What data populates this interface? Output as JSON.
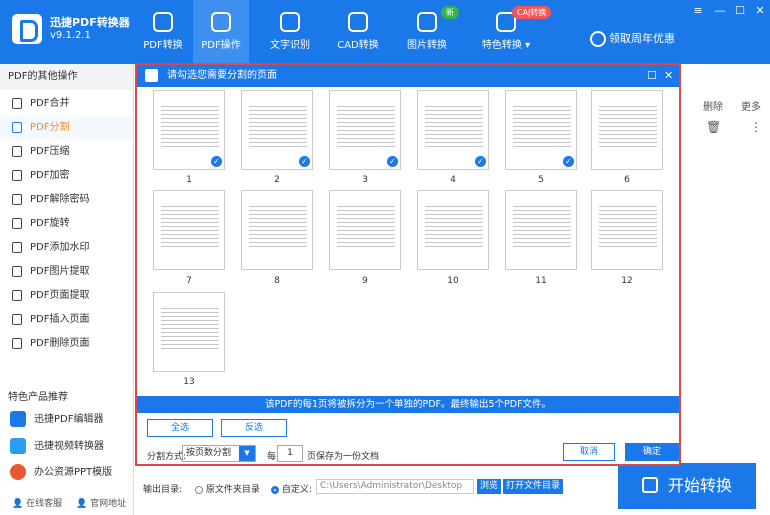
{
  "app": {
    "name": "迅捷PDF转换器",
    "version": "v9.1.2.1"
  },
  "nav": [
    {
      "label": "PDF转换",
      "icon": "convert-icon"
    },
    {
      "label": "PDF操作",
      "icon": "pdf-operate-icon",
      "active": true
    },
    {
      "label": "文字识别",
      "icon": "ocr-icon"
    },
    {
      "label": "CAD转换",
      "icon": "cad-icon"
    },
    {
      "label": "图片转换",
      "icon": "image-icon",
      "badge": "新"
    },
    {
      "label": "特色转换",
      "icon": "special-icon",
      "badge": "CAJ转换"
    }
  ],
  "promo": "领取周年优惠",
  "sidebar": {
    "heading": "PDF的其他操作",
    "items": [
      {
        "label": "PDF合并",
        "icon": "merge-icon"
      },
      {
        "label": "PDF分割",
        "icon": "split-icon",
        "active": true
      },
      {
        "label": "PDF压缩",
        "icon": "compress-icon"
      },
      {
        "label": "PDF加密",
        "icon": "lock-icon"
      },
      {
        "label": "PDF解除密码",
        "icon": "unlock-icon"
      },
      {
        "label": "PDF旋转",
        "icon": "rotate-icon"
      },
      {
        "label": "PDF添加水印",
        "icon": "watermark-icon"
      },
      {
        "label": "PDF图片提取",
        "icon": "image-extract-icon"
      },
      {
        "label": "PDF页面提取",
        "icon": "page-extract-icon"
      },
      {
        "label": "PDF插入页面",
        "icon": "insert-page-icon"
      },
      {
        "label": "PDF删除页面",
        "icon": "delete-page-icon"
      }
    ],
    "products_heading": "特色产品推荐",
    "products": [
      "迅捷PDF编辑器",
      "迅捷视频转换器",
      "办公资源PPT模版"
    ],
    "footer": [
      "在线客服",
      "官网地址"
    ]
  },
  "table_cols": {
    "delete": "删除",
    "more": "更多"
  },
  "dialog": {
    "title": "请勾选您需要分割的页面",
    "pages": [
      {
        "n": "1",
        "checked": true
      },
      {
        "n": "2",
        "checked": true
      },
      {
        "n": "3",
        "checked": true
      },
      {
        "n": "4",
        "checked": true
      },
      {
        "n": "5",
        "checked": true
      },
      {
        "n": "6",
        "checked": false
      },
      {
        "n": "7",
        "checked": false
      },
      {
        "n": "8",
        "checked": false
      },
      {
        "n": "9",
        "checked": false
      },
      {
        "n": "10",
        "checked": false
      },
      {
        "n": "11",
        "checked": false
      },
      {
        "n": "12",
        "checked": false
      },
      {
        "n": "13",
        "checked": false
      }
    ],
    "info": "该PDF的每1页将被拆分为一个单独的PDF。最终输出5个PDF文件。",
    "select_all": "全选",
    "invert": "反选",
    "mode_label": "分割方式:",
    "mode_value": "按页数分割",
    "every": "每",
    "every_value": "1",
    "save_label": "页保存为一份文档",
    "cancel": "取消",
    "ok": "确定"
  },
  "output": {
    "label": "输出目录:",
    "opt_original": "原文件夹目录",
    "opt_custom": "自定义:",
    "path": "C:\\Users\\Administrator\\Desktop",
    "browse": "浏览",
    "open": "打开文件目录"
  },
  "start": "开始转换"
}
